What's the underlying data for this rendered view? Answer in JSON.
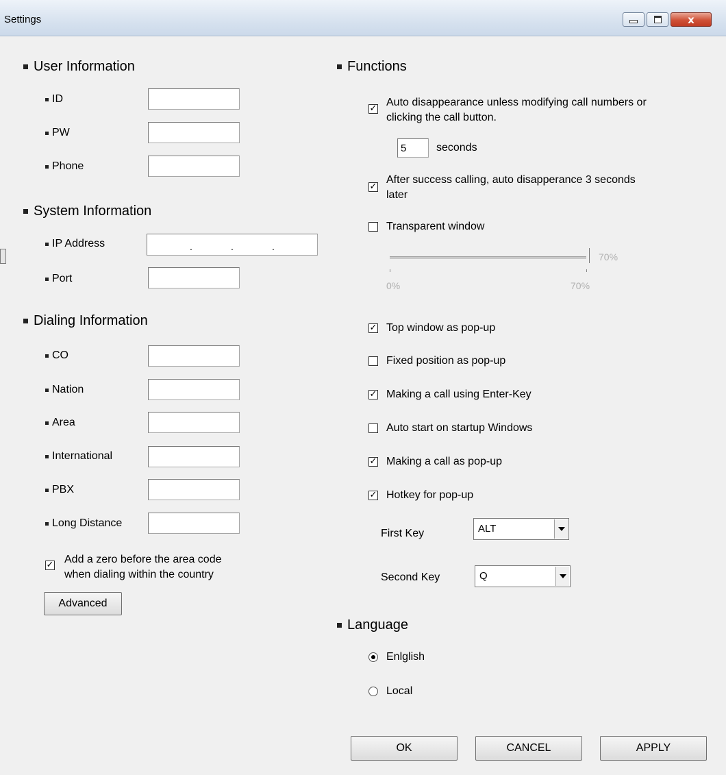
{
  "window": {
    "title": "Settings",
    "controls": {
      "minimize": "minimize",
      "maximize": "maximize",
      "close": "x"
    }
  },
  "user_info": {
    "heading": "User Information",
    "fields": [
      {
        "label": "ID",
        "value": ""
      },
      {
        "label": "PW",
        "value": ""
      },
      {
        "label": "Phone",
        "value": ""
      }
    ]
  },
  "system_info": {
    "heading": "System Information",
    "ip_label": "IP Address",
    "ip_value": "",
    "port_label": "Port",
    "port_value": ""
  },
  "dialing_info": {
    "heading": "Dialing Information",
    "fields": [
      {
        "label": "CO",
        "value": ""
      },
      {
        "label": "Nation",
        "value": ""
      },
      {
        "label": "Area",
        "value": ""
      },
      {
        "label": "International",
        "value": ""
      },
      {
        "label": "PBX",
        "value": ""
      },
      {
        "label": "Long Distance",
        "value": ""
      }
    ],
    "zero_prefix": {
      "checked": true,
      "line1": "Add a zero before the area code",
      "line2": "when dialing within the country"
    },
    "advanced_button": "Advanced"
  },
  "functions": {
    "heading": "Functions",
    "auto_disappear": {
      "checked": true,
      "line1": "Auto disappearance unless modifying call numbers or",
      "line2": "clicking the call button.",
      "seconds_value": "5",
      "seconds_label": "seconds"
    },
    "success_disappear": {
      "checked": true,
      "line1": "After success calling, auto disapperance 3 seconds",
      "line2": "later"
    },
    "transparent": {
      "checked": false,
      "label": "Transparent window",
      "value_percent": 70,
      "value_label": "70%",
      "min_label": "0%",
      "max_label": "70%"
    },
    "options": [
      {
        "label": "Top window as pop-up",
        "checked": true
      },
      {
        "label": "Fixed position as pop-up",
        "checked": false
      },
      {
        "label": "Making a call using Enter-Key",
        "checked": true
      },
      {
        "label": "Auto start on startup Windows",
        "checked": false
      },
      {
        "label": "Making a call as pop-up",
        "checked": true
      },
      {
        "label": "Hotkey for pop-up",
        "checked": true
      }
    ],
    "first_key": {
      "label": "First Key",
      "value": "ALT"
    },
    "second_key": {
      "label": "Second Key",
      "value": "Q"
    }
  },
  "language": {
    "heading": "Language",
    "options": [
      {
        "label": "Enlglish",
        "selected": true
      },
      {
        "label": "Local",
        "selected": false
      }
    ]
  },
  "buttons": {
    "ok": "OK",
    "cancel": "CANCEL",
    "apply": "APPLY"
  }
}
